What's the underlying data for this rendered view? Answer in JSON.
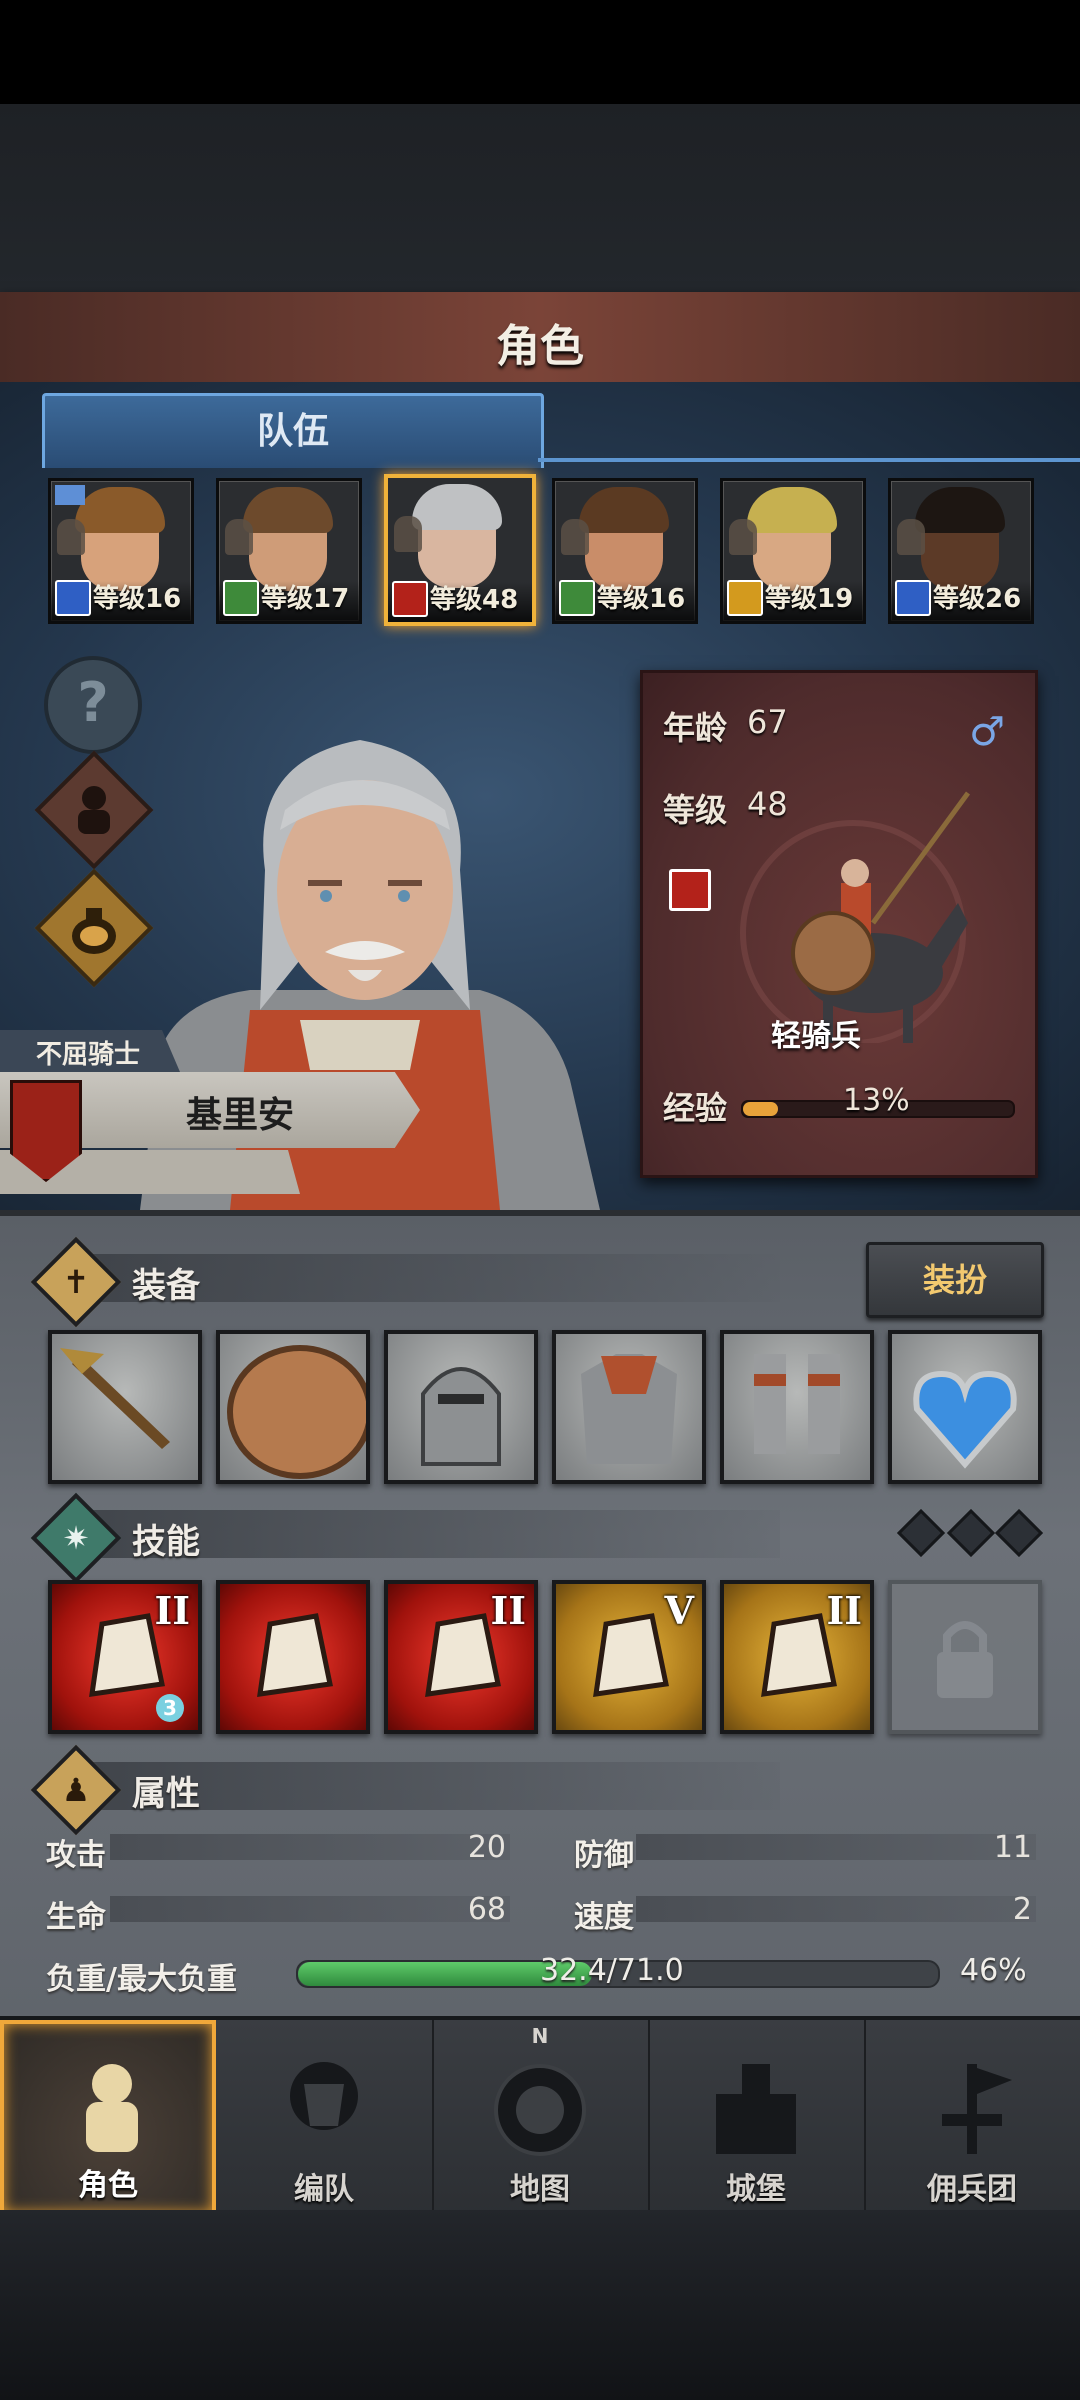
{
  "header": {
    "title": "角色"
  },
  "tabs": [
    {
      "label": "队伍",
      "active": true
    }
  ],
  "party": [
    {
      "level_text": "等级16",
      "class_icon": "spear-icon",
      "class_color": "#2f5fc4",
      "hair": "#8a5a2a",
      "skin": "#d7a27b",
      "selected": false,
      "leader_flag": true
    },
    {
      "level_text": "等级17",
      "class_icon": "crossbow-icon",
      "class_color": "#3e8a3a",
      "hair": "#6d4a2c",
      "skin": "#cf9c78",
      "selected": false
    },
    {
      "level_text": "等级48",
      "class_icon": "horse-icon",
      "class_color": "#b3221a",
      "hair": "#bfc1c3",
      "skin": "#d9b6a0",
      "selected": true
    },
    {
      "level_text": "等级16",
      "class_icon": "crossbow-icon",
      "class_color": "#3e8a3a",
      "hair": "#5b3a22",
      "skin": "#c98d69",
      "selected": false
    },
    {
      "level_text": "等级19",
      "class_icon": "shield-icon",
      "class_color": "#d39a1e",
      "hair": "#c6b050",
      "skin": "#d8a883",
      "selected": false
    },
    {
      "level_text": "等级26",
      "class_icon": "spear-icon",
      "class_color": "#2f5fc4",
      "hair": "#1d1612",
      "skin": "#5c3a27",
      "selected": false
    }
  ],
  "side_buttons": [
    {
      "name": "help",
      "glyph": "?"
    },
    {
      "name": "squad",
      "icon": "soldier-icon"
    },
    {
      "name": "inventory",
      "icon": "bag-icon"
    }
  ],
  "character": {
    "title": "不屈骑士",
    "name": "基里安",
    "age_label": "年龄",
    "age": "67",
    "level_label": "等级",
    "level": "48",
    "sex_symbol": "♂",
    "unit_type": "轻骑兵",
    "exp_label": "经验",
    "exp_percent_text": "13%",
    "exp_fraction": 0.13
  },
  "equipment": {
    "section_title": "装备",
    "section_glyph": "✝",
    "dress_button": "装扮",
    "slots": [
      "spear-icon",
      "round-shield-icon",
      "helmet-icon",
      "chainmail-icon",
      "boots-icon",
      "amulet-icon"
    ]
  },
  "skills": {
    "section_title": "技能",
    "section_glyph": "✷",
    "slots": [
      {
        "icon": "sword-charge-icon",
        "style": "red",
        "rank": "II",
        "charges": "3"
      },
      {
        "icon": "horse-shield-bash-icon",
        "style": "red",
        "rank": ""
      },
      {
        "icon": "shield-charge-icon",
        "style": "red",
        "rank": "II"
      },
      {
        "icon": "shield-block-icon",
        "style": "gold",
        "rank": "V"
      },
      {
        "icon": "shield-icon",
        "style": "gold",
        "rank": "II"
      },
      {
        "icon": "lock-icon",
        "style": "locked",
        "rank": ""
      }
    ]
  },
  "attributes": {
    "section_title": "属性",
    "section_glyph": "♟",
    "attack_label": "攻击",
    "attack": "20",
    "defense_label": "防御",
    "defense": "11",
    "hp_label": "生命",
    "hp": "68",
    "speed_label": "速度",
    "speed": "2",
    "load_label": "负重/最大负重",
    "load_text": "32.4/71.0",
    "load_percent_text": "46%",
    "load_fraction": 0.46
  },
  "nav": [
    {
      "label": "角色",
      "icon": "knight-icon",
      "active": true
    },
    {
      "label": "编队",
      "icon": "squad-icon",
      "active": false
    },
    {
      "label": "地图",
      "icon": "compass-map-icon",
      "active": false,
      "compass_letter": "N"
    },
    {
      "label": "城堡",
      "icon": "castle-icon",
      "active": false
    },
    {
      "label": "佣兵团",
      "icon": "mercenary-icon",
      "active": false
    }
  ],
  "colors": {
    "accent_gold": "#f0b23a",
    "tab_blue": "#6ea7e0",
    "exp_orange": "#e8a23a",
    "load_green": "#3f9f4c"
  }
}
